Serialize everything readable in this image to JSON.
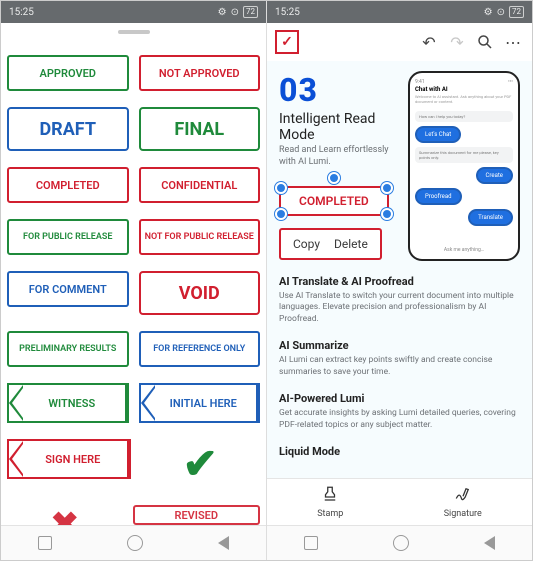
{
  "status": {
    "time": "15:25",
    "signal": "ᯤ",
    "battery": "72"
  },
  "left": {
    "stamps": {
      "approved": "APPROVED",
      "not_approved": "NOT APPROVED",
      "draft": "DRAFT",
      "final": "FINAL",
      "completed": "COMPLETED",
      "confidential": "CONFIDENTIAL",
      "public": "FOR PUBLIC RELEASE",
      "not_public": "NOT FOR PUBLIC RELEASE",
      "comment": "FOR COMMENT",
      "void": "VOID",
      "prelim": "PRELIMINARY RESULTS",
      "reference": "FOR REFERENCE ONLY",
      "witness": "WITNESS",
      "initial": "INITIAL HERE",
      "sign": "SIGN HERE",
      "revised": "REVISED"
    }
  },
  "right": {
    "toolbar": {
      "check": "✓"
    },
    "doc": {
      "num": "03",
      "title": "Intelligent Read Mode",
      "sub1": "Read and Learn effortlessly",
      "sub2": "with AI Lumi.",
      "phone": {
        "title": "Chat with AI",
        "lets_chat": "Let's Chat",
        "create": "Create",
        "proofread": "Proofread",
        "translate": "Translate"
      },
      "selected_stamp": "COMPLETED",
      "ctx": {
        "copy": "Copy",
        "delete": "Delete"
      },
      "sec1": {
        "h": "AI Translate & AI Proofread",
        "p": "Use AI Translate to switch your current document into multiple languages. Elevate precision and professionalism by AI Proofread."
      },
      "sec2": {
        "h": "AI Summarize",
        "p": "AI Lumi can extract key points swiftly and create concise summaries to save your time."
      },
      "sec3": {
        "h": "AI-Powered Lumi",
        "p": "Get accurate insights by asking Lumi detailed queries, covering PDF-related topics or any subject matter."
      },
      "sec4": {
        "h": "Liquid Mode"
      }
    },
    "tabs": {
      "stamp": "Stamp",
      "signature": "Signature"
    }
  }
}
